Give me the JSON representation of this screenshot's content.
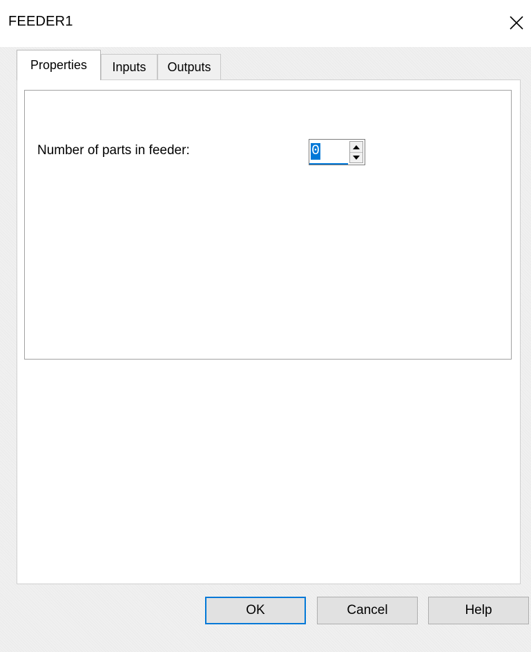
{
  "window": {
    "title": "FEEDER1"
  },
  "tabs": [
    {
      "label": "Properties",
      "active": true
    },
    {
      "label": "Inputs",
      "active": false
    },
    {
      "label": "Outputs",
      "active": false
    }
  ],
  "properties": {
    "parts_label": "Number of parts in feeder:",
    "parts_value": "0"
  },
  "buttons": {
    "ok": "OK",
    "cancel": "Cancel",
    "help": "Help"
  },
  "colors": {
    "accent": "#0078d7",
    "dialog_bg": "#f0f0f0",
    "button_bg": "#e1e1e1"
  }
}
